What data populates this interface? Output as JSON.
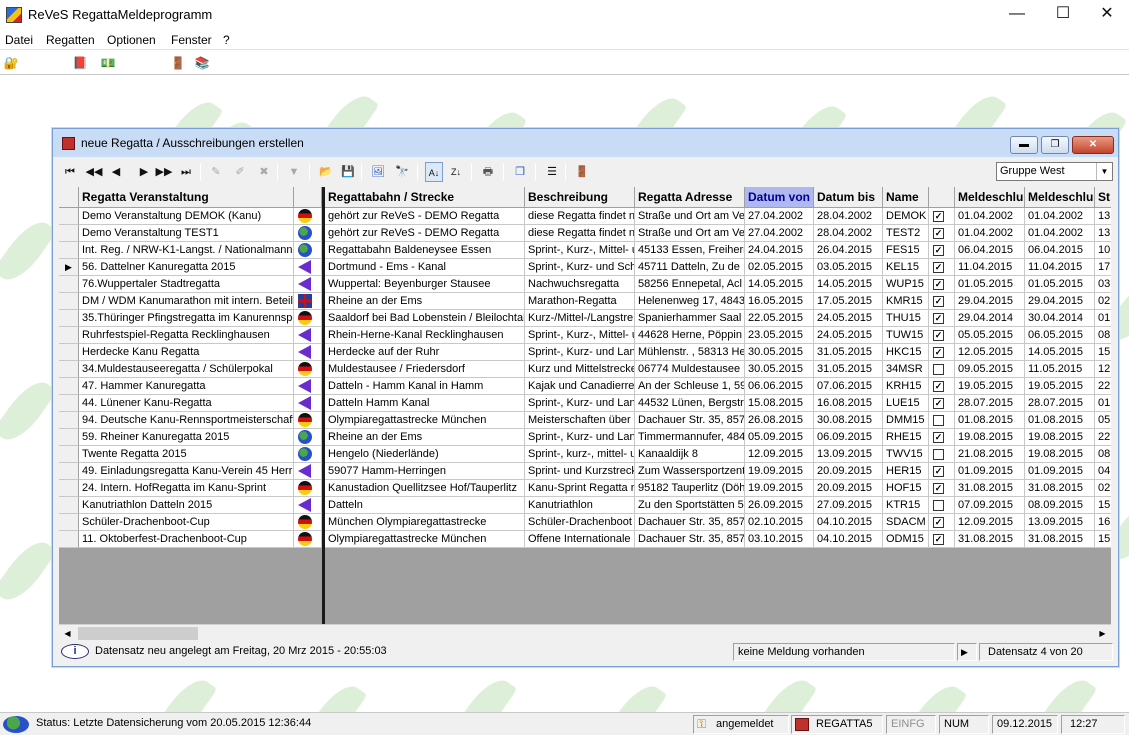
{
  "app": {
    "title": "ReVeS  RegattaMeldeprogramm",
    "window_controls": {
      "minimize": "—",
      "maximize": "☐",
      "close": "✕"
    }
  },
  "menu": [
    "Datei",
    "Regatten",
    "Optionen",
    "Fenster",
    "?"
  ],
  "app_toolbar": {
    "icons": [
      "key-lock-icon",
      "book-icon",
      "cash-icon",
      "exit-door-icon",
      "books-icon"
    ]
  },
  "mdi_window": {
    "title": "neue Regatta / Ausschreibungen erstellen",
    "controls": {
      "minimize": "▬",
      "restore": "❐",
      "close": "✕"
    },
    "group_select": {
      "value": "Gruppe West"
    },
    "toolbar": {
      "first": "⏮",
      "prev_page": "◀◀",
      "prev": "◀",
      "next": "▶",
      "next_page": "▶▶",
      "last": "⏭"
    },
    "left_columns": [
      "Regatta Veranstaltung"
    ],
    "right_columns": [
      "Regattabahn / Strecke",
      "Beschreibung",
      "Regatta Adresse",
      "Datum von",
      "Datum bis",
      "Name",
      "",
      "Meldeschlu",
      "Meldeschlu",
      "St"
    ],
    "current_row": 3,
    "rows": [
      {
        "veranstaltung": "Demo Veranstaltung DEMOK (Kanu)",
        "flag": "de",
        "strecke": "gehört zur ReVeS - DEMO Regatta",
        "beschreibung": "diese Regatta findet n",
        "adresse": "Straße und Ort am Ve",
        "von": "27.04.2002",
        "bis": "28.04.2002",
        "name": "DEMOK",
        "checked": true,
        "ms1": "01.04.2002",
        "ms2": "01.04.2002",
        "st": "13"
      },
      {
        "veranstaltung": "Demo Veranstaltung TEST1",
        "flag": "globe",
        "strecke": "gehört zur ReVeS - DEMO Regatta",
        "beschreibung": "diese Regatta findet n",
        "adresse": "Straße und Ort am Ve",
        "von": "27.04.2002",
        "bis": "28.04.2002",
        "name": "TEST2",
        "checked": true,
        "ms1": "01.04.2002",
        "ms2": "01.04.2002",
        "st": "13"
      },
      {
        "veranstaltung": "Int. Reg. / NRW-K1-Langst. / Nationalmann",
        "flag": "globe",
        "strecke": "Regattabahn Baldeneysee Essen",
        "beschreibung": "Sprint-, Kurz-, Mittel- u",
        "adresse": "45133 Essen, Freiherr",
        "von": "24.04.2015",
        "bis": "26.04.2015",
        "name": "FES15",
        "checked": true,
        "ms1": "06.04.2015",
        "ms2": "06.04.2015",
        "st": "10"
      },
      {
        "veranstaltung": "56. Dattelner Kanuregatta 2015",
        "flag": "tri",
        "strecke": "Dortmund - Ems - Kanal",
        "beschreibung": "Sprint-, Kurz- und Sch",
        "adresse": "45711 Datteln, Zu de",
        "von": "02.05.2015",
        "bis": "03.05.2015",
        "name": "KEL15",
        "checked": true,
        "ms1": "11.04.2015",
        "ms2": "11.04.2015",
        "st": "17"
      },
      {
        "veranstaltung": "76.Wuppertaler Stadtregatta",
        "flag": "tri",
        "strecke": "Wuppertal: Beyenburger Stausee",
        "beschreibung": "Nachwuchsregatta",
        "adresse": "58256 Ennepetal, Acl",
        "von": "14.05.2015",
        "bis": "14.05.2015",
        "name": "WUP15",
        "checked": true,
        "ms1": "01.05.2015",
        "ms2": "01.05.2015",
        "st": "03"
      },
      {
        "veranstaltung": "DM / WDM Kanumarathon mit intern. Beteili",
        "flag": "uk",
        "strecke": "Rheine an der Ems",
        "beschreibung": "Marathon-Regatta",
        "adresse": "Helenenweg 17, 4843",
        "von": "16.05.2015",
        "bis": "17.05.2015",
        "name": "KMR15",
        "checked": true,
        "ms1": "29.04.2015",
        "ms2": "29.04.2015",
        "st": "02"
      },
      {
        "veranstaltung": "35.Thüringer Pfingstregatta im Kanurennspo",
        "flag": "de",
        "strecke": "Saaldorf bei Bad Lobenstein / Bleilochtal",
        "beschreibung": "Kurz-/Mittel-/Langstre",
        "adresse": "Spanierhammer Saal",
        "von": "22.05.2015",
        "bis": "24.05.2015",
        "name": "THU15",
        "checked": true,
        "ms1": "29.04.2014",
        "ms2": "30.04.2014",
        "st": "01"
      },
      {
        "veranstaltung": "Ruhrfestspiel-Regatta Recklinghausen",
        "flag": "tri",
        "strecke": "Rhein-Herne-Kanal Recklinghausen",
        "beschreibung": "Sprint-, Kurz-, Mittel- u",
        "adresse": "44628 Herne, Pöppin",
        "von": "23.05.2015",
        "bis": "24.05.2015",
        "name": "TUW15",
        "checked": true,
        "ms1": "05.05.2015",
        "ms2": "06.05.2015",
        "st": "08"
      },
      {
        "veranstaltung": "Herdecke Kanu Regatta",
        "flag": "tri",
        "strecke": "Herdecke auf der Ruhr",
        "beschreibung": "Sprint-, Kurz- und Lan",
        "adresse": "Mühlenstr. , 58313 He",
        "von": "30.05.2015",
        "bis": "31.05.2015",
        "name": "HKC15",
        "checked": true,
        "ms1": "12.05.2015",
        "ms2": "14.05.2015",
        "st": "15"
      },
      {
        "veranstaltung": "34.Muldestauseeregatta / Schülerpokal",
        "flag": "de",
        "strecke": "Muldestausee / Friedersdorf",
        "beschreibung": "Kurz und Mittelstrecke",
        "adresse": "06774 Muldestausee",
        "von": "30.05.2015",
        "bis": "31.05.2015",
        "name": "34MSR",
        "checked": false,
        "ms1": "09.05.2015",
        "ms2": "11.05.2015",
        "st": "12"
      },
      {
        "veranstaltung": "47. Hammer Kanuregatta",
        "flag": "tri",
        "strecke": "Datteln - Hamm Kanal in Hamm",
        "beschreibung": "Kajak und Canadierre",
        "adresse": "An der Schleuse 1, 59",
        "von": "06.06.2015",
        "bis": "07.06.2015",
        "name": "KRH15",
        "checked": true,
        "ms1": "19.05.2015",
        "ms2": "19.05.2015",
        "st": "22"
      },
      {
        "veranstaltung": "44. Lünener Kanu-Regatta",
        "flag": "tri",
        "strecke": "Datteln Hamm Kanal",
        "beschreibung": "Sprint-, Kurz- und Lan",
        "adresse": "44532 Lünen, Bergstr",
        "von": "15.08.2015",
        "bis": "16.08.2015",
        "name": "LUE15",
        "checked": true,
        "ms1": "28.07.2015",
        "ms2": "28.07.2015",
        "st": "01"
      },
      {
        "veranstaltung": "94. Deutsche Kanu-Rennsportmeisterschaft",
        "flag": "de",
        "strecke": "Olympiaregattastrecke München",
        "beschreibung": "Meisterschaften über",
        "adresse": "Dachauer Str. 35, 857",
        "von": "26.08.2015",
        "bis": "30.08.2015",
        "name": "DMM15",
        "checked": false,
        "ms1": "01.08.2015",
        "ms2": "01.08.2015",
        "st": "05"
      },
      {
        "veranstaltung": "59. Rheiner Kanuregatta 2015",
        "flag": "globe",
        "strecke": "Rheine an der Ems",
        "beschreibung": "Sprint-, Kurz- und Lan",
        "adresse": "Timmermannufer, 484",
        "von": "05.09.2015",
        "bis": "06.09.2015",
        "name": "RHE15",
        "checked": true,
        "ms1": "19.08.2015",
        "ms2": "19.08.2015",
        "st": "22"
      },
      {
        "veranstaltung": "Twente Regatta 2015",
        "flag": "globe",
        "strecke": "Hengelo (Niederlände)",
        "beschreibung": "Sprint-, kurz-, mittel- u",
        "adresse": "Kanaaldijk 8",
        "von": "12.09.2015",
        "bis": "13.09.2015",
        "name": "TWV15",
        "checked": false,
        "ms1": "21.08.2015",
        "ms2": "19.08.2015",
        "st": "08"
      },
      {
        "veranstaltung": "49. Einladungsregatta Kanu-Verein 45 Herrin",
        "flag": "tri",
        "strecke": "59077 Hamm-Herringen",
        "beschreibung": "Sprint- und Kurzstreck",
        "adresse": "Zum Wassersportzent",
        "von": "19.09.2015",
        "bis": "20.09.2015",
        "name": "HER15",
        "checked": true,
        "ms1": "01.09.2015",
        "ms2": "01.09.2015",
        "st": "04"
      },
      {
        "veranstaltung": "24. Intern. HofRegatta im Kanu-Sprint",
        "flag": "de",
        "strecke": "Kanustadion Quellitzsee   Hof/Tauperlitz",
        "beschreibung": "Kanu-Sprint Regatta r",
        "adresse": "95182 Tauperlitz (Döh",
        "von": "19.09.2015",
        "bis": "20.09.2015",
        "name": "HOF15",
        "checked": true,
        "ms1": "31.08.2015",
        "ms2": "31.08.2015",
        "st": "02"
      },
      {
        "veranstaltung": "Kanutriathlon Datteln 2015",
        "flag": "tri",
        "strecke": "Datteln",
        "beschreibung": "Kanutriathlon",
        "adresse": "Zu den Sportstätten 5",
        "von": "26.09.2015",
        "bis": "27.09.2015",
        "name": "KTR15",
        "checked": false,
        "ms1": "07.09.2015",
        "ms2": "08.09.2015",
        "st": "15"
      },
      {
        "veranstaltung": "Schüler-Drachenboot-Cup",
        "flag": "de",
        "strecke": "München Olympiaregattastrecke",
        "beschreibung": "Schüler-Drachenboot",
        "adresse": "Dachauer Str. 35, 857",
        "von": "02.10.2015",
        "bis": "04.10.2015",
        "name": "SDACM",
        "checked": true,
        "ms1": "12.09.2015",
        "ms2": "13.09.2015",
        "st": "16"
      },
      {
        "veranstaltung": "11. Oktoberfest-Drachenboot-Cup",
        "flag": "de",
        "strecke": "Olympiaregattastrecke München",
        "beschreibung": "Offene Internationale",
        "adresse": "Dachauer Str. 35, 857",
        "von": "03.10.2015",
        "bis": "04.10.2015",
        "name": "ODM15",
        "checked": true,
        "ms1": "31.08.2015",
        "ms2": "31.08.2015",
        "st": "15"
      }
    ],
    "status": {
      "info": "Datensatz neu angelegt am Freitag, 20 Mrz 2015  -  20:55:03",
      "meldung": "keine Meldung vorhanden",
      "datensatz": "Datensatz 4 von 20"
    }
  },
  "statusbar": {
    "status": "Status:  Letzte Datensicherung vom  20.05.2015  12:36:44",
    "user": "angemeldet",
    "db": "REGATTA5",
    "einfg": "EINFG",
    "num": "NUM",
    "date": "09.12.2015",
    "time": "12:27"
  }
}
